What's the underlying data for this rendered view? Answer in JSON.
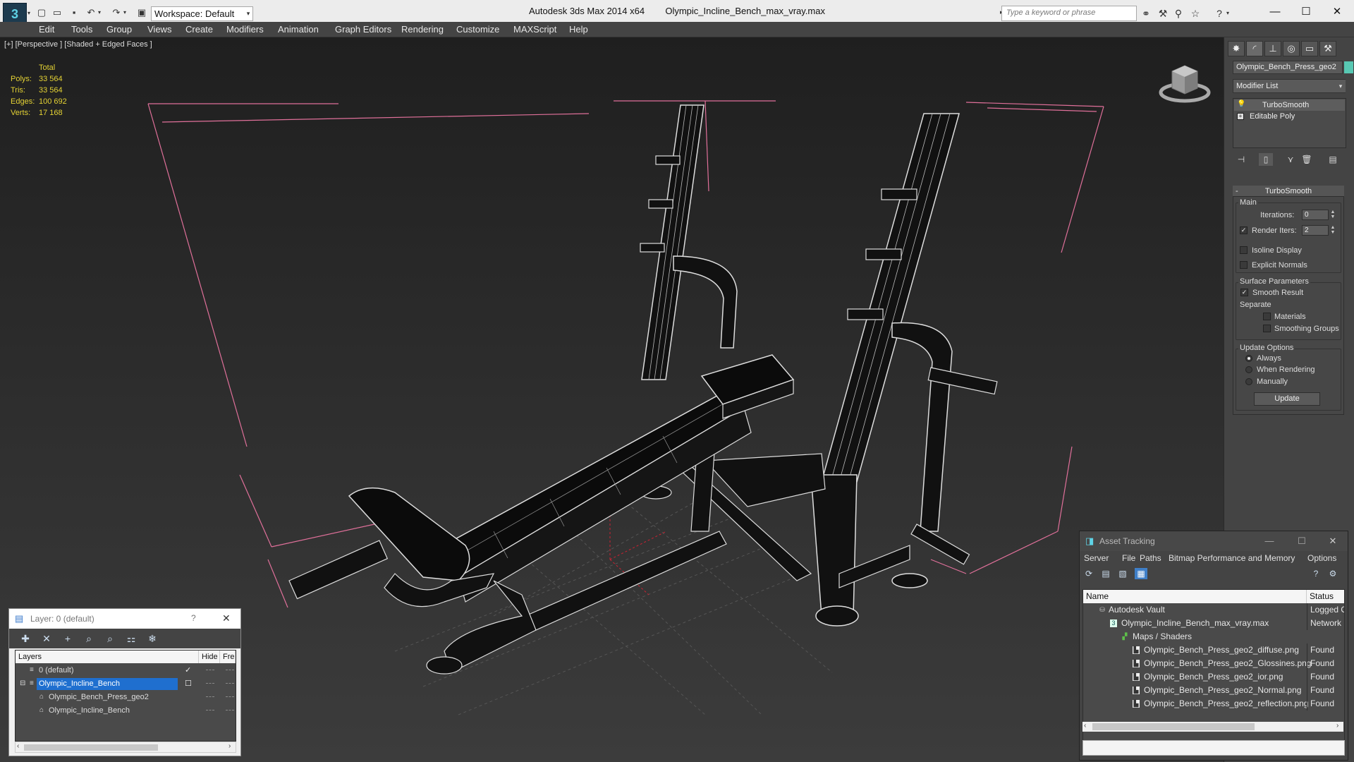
{
  "app": {
    "title": "Autodesk 3ds Max  2014 x64",
    "file": "Olympic_Incline_Bench_max_vray.max",
    "logo": "3ds-max-logo",
    "workspace": "Workspace: Default",
    "search_placeholder": "Type a keyword or phrase"
  },
  "menubar": {
    "items": [
      "Edit",
      "Tools",
      "Group",
      "Views",
      "Create",
      "Modifiers",
      "Animation",
      "Graph Editors",
      "Rendering",
      "Customize",
      "MAXScript",
      "Help"
    ]
  },
  "viewport": {
    "label": "[+] [Perspective ] [Shaded + Edged Faces ]",
    "stats": {
      "header": "Total",
      "polys_label": "Polys:",
      "polys": "33 564",
      "tris_label": "Tris:",
      "tris": "33 564",
      "edges_label": "Edges:",
      "edges": "100 692",
      "verts_label": "Verts:",
      "verts": "17 168"
    },
    "colors": {
      "wire": "#ffffff",
      "bbox": "#e0709a",
      "grid": "#5a5a5a",
      "stats": "#e4d234"
    }
  },
  "command_panel": {
    "tabs": [
      "create-tab-icon",
      "modify-tab-icon",
      "hierarchy-tab-icon",
      "motion-tab-icon",
      "display-tab-icon",
      "utilities-tab-icon"
    ],
    "object_name": "Olympic_Bench_Press_geo2",
    "object_color": "#58c8b3",
    "modifier_list": "Modifier List",
    "stack": [
      "TurboSmooth",
      "Editable Poly"
    ],
    "rollout": {
      "title": "TurboSmooth",
      "main_group": "Main",
      "iterations_label": "Iterations:",
      "iterations": "0",
      "render_iters_label": "Render Iters:",
      "render_iters": "2",
      "render_iters_checked": true,
      "isoline_label": "Isoline Display",
      "explicit_label": "Explicit Normals",
      "surface_group": "Surface Parameters",
      "smooth_result_label": "Smooth Result",
      "smooth_result_checked": true,
      "separate_label": "Separate",
      "materials_label": "Materials",
      "smoothing_groups_label": "Smoothing Groups",
      "update_group": "Update Options",
      "always_label": "Always",
      "when_rendering_label": "When Rendering",
      "manually_label": "Manually",
      "update_button": "Update"
    }
  },
  "layer_window": {
    "title": "Layer: 0 (default)",
    "help": "?",
    "close": "✕",
    "columns": [
      "Layers",
      "Hide",
      "Fre"
    ],
    "rows": [
      {
        "name": "0 (default)",
        "indent": 0,
        "selected": false,
        "check": "✓"
      },
      {
        "name": "Olympic_Incline_Bench",
        "indent": 0,
        "selected": true,
        "check": "☐"
      },
      {
        "name": "Olympic_Bench_Press_geo2",
        "indent": 1,
        "selected": false,
        "check": ""
      },
      {
        "name": "Olympic_Incline_Bench",
        "indent": 1,
        "selected": false,
        "check": ""
      }
    ]
  },
  "asset_window": {
    "title": "Asset Tracking",
    "menu": [
      "Server",
      "File",
      "Paths",
      "Bitmap Performance and Memory",
      "Options"
    ],
    "columns": [
      "Name",
      "Status"
    ],
    "rows": [
      {
        "name": "Autodesk Vault",
        "status": "Logged O",
        "indent": 0,
        "icon": "vault"
      },
      {
        "name": "Olympic_Incline_Bench_max_vray.max",
        "status": "Network",
        "indent": 1,
        "icon": "max-file"
      },
      {
        "name": "Maps / Shaders",
        "status": "",
        "indent": 2,
        "icon": "maps"
      },
      {
        "name": "Olympic_Bench_Press_geo2_diffuse.png",
        "status": "Found",
        "indent": 3,
        "icon": "image"
      },
      {
        "name": "Olympic_Bench_Press_geo2_Glossines.png",
        "status": "Found",
        "indent": 3,
        "icon": "image"
      },
      {
        "name": "Olympic_Bench_Press_geo2_ior.png",
        "status": "Found",
        "indent": 3,
        "icon": "image"
      },
      {
        "name": "Olympic_Bench_Press_geo2_Normal.png",
        "status": "Found",
        "indent": 3,
        "icon": "image"
      },
      {
        "name": "Olympic_Bench_Press_geo2_reflection.png",
        "status": "Found",
        "indent": 3,
        "icon": "image"
      }
    ]
  }
}
